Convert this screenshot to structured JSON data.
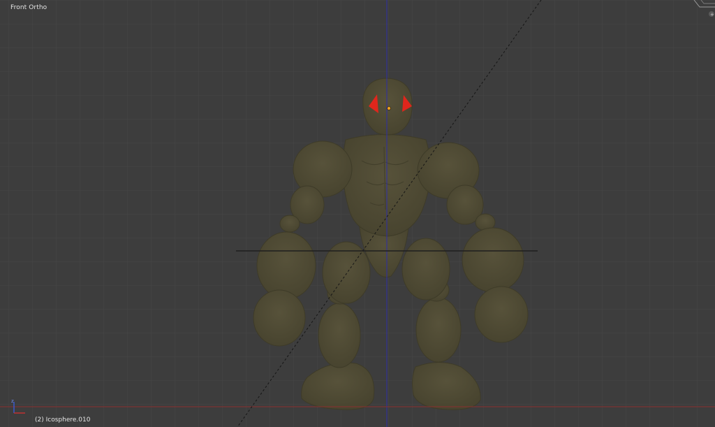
{
  "viewport": {
    "view_label": "Front Ortho",
    "object_label": "(2) Icosphere.010"
  },
  "icons": {
    "axis_gizmo": "axis-gizmo-icon",
    "corner_split": "corner-split-icon",
    "object_origin": "object-origin-icon"
  },
  "colors": {
    "background": "#3d3d3d",
    "grid": "#474747",
    "z_axis": "#2e2ea8",
    "x_axis": "#8a2f2f",
    "body": "#4f4b35",
    "body_shadow": "#3f3c2a",
    "eye": "#e0261c",
    "origin": "#f0a020",
    "ground": "#1e1e1e"
  }
}
